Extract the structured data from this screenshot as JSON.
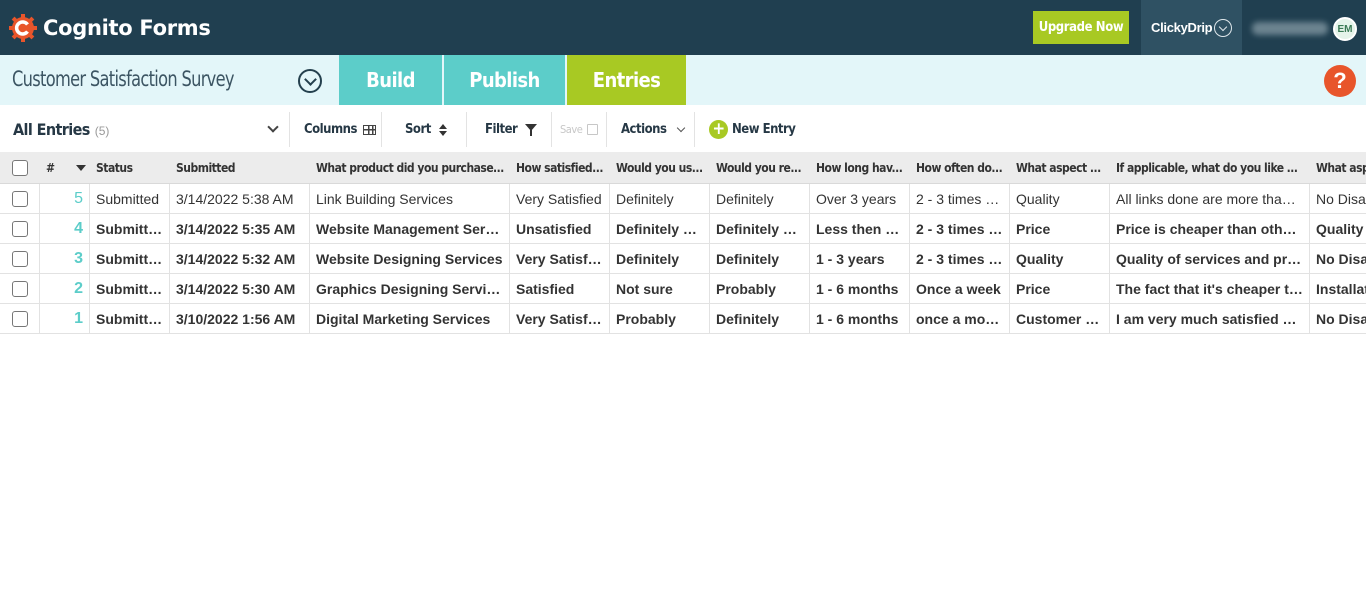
{
  "app": {
    "name": "Cognito Forms",
    "upgrade_label": "Upgrade Now",
    "org_name": "ClickyDrip",
    "user_initials": "EM"
  },
  "form": {
    "title": "Customer Satisfaction Survey",
    "tabs": {
      "build": "Build",
      "publish": "Publish",
      "entries": "Entries"
    },
    "help_label": "?"
  },
  "toolbar": {
    "view_name": "All Entries",
    "view_count": "(5)",
    "columns": "Columns",
    "sort": "Sort",
    "filter": "Filter",
    "save": "Save",
    "actions": "Actions",
    "new_entry_plus": "+",
    "new_entry": "New Entry"
  },
  "table": {
    "headers": {
      "num": "#",
      "status": "Status",
      "submitted": "Submitted",
      "c1": "What product did you purchase o...",
      "c2": "How satisfied...",
      "c3": "Would you us...",
      "c4": "Would you re...",
      "c5": "How long hav...",
      "c6": "How often do...",
      "c7": "What aspect ...",
      "c8": "If applicable, what do you like ab...",
      "c9": "What aspe"
    },
    "rows": [
      {
        "num": "5",
        "status": "Submitted",
        "submitted": "3/14/2022 5:38 AM",
        "c1": "Link Building Services",
        "c2": "Very Satisfied",
        "c3": "Definitely",
        "c4": "Definitely",
        "c5": "Over 3 years",
        "c6": "2 - 3 times a...",
        "c7": "Quality",
        "c8": "All links done are more than w...",
        "c9": "No Disap"
      },
      {
        "num": "4",
        "status": "Submitted",
        "submitted": "3/14/2022 5:35 AM",
        "c1": "Website Management Servi...",
        "c2": "Unsatisfied",
        "c3": "Definitely not",
        "c4": "Definitely not",
        "c5": "Less then a...",
        "c6": "2 - 3 times a...",
        "c7": "Price",
        "c8": "Price is cheaper than others...",
        "c9": "Quality"
      },
      {
        "num": "3",
        "status": "Submitted",
        "submitted": "3/14/2022 5:32 AM",
        "c1": "Website Designing Services",
        "c2": "Very Satisfied",
        "c3": "Definitely",
        "c4": "Definitely",
        "c5": "1 - 3 years",
        "c6": "2 - 3 times a...",
        "c7": "Quality",
        "c8": "Quality of services and prod...",
        "c9": "No Disap"
      },
      {
        "num": "2",
        "status": "Submitted",
        "submitted": "3/14/2022 5:30 AM",
        "c1": "Graphics Designing Services",
        "c2": "Satisfied",
        "c3": "Not sure",
        "c4": "Probably",
        "c5": "1 - 6 months",
        "c6": "Once a week",
        "c7": "Price",
        "c8": "The fact that it's cheaper th...",
        "c9": "Installat"
      },
      {
        "num": "1",
        "status": "Submitted",
        "submitted": "3/10/2022 1:56 AM",
        "c1": "Digital Marketing Services",
        "c2": "Very Satisfied",
        "c3": "Probably",
        "c4": "Definitely",
        "c5": "1 - 6 months",
        "c6": "once a month",
        "c7": "Customer s...",
        "c8": "I am very much satisfied wit...",
        "c9": "No Disap"
      }
    ]
  },
  "colors": {
    "topbar": "#203f50",
    "teal": "#5ccdc9",
    "green": "#a8c923",
    "help": "#e8552b"
  }
}
